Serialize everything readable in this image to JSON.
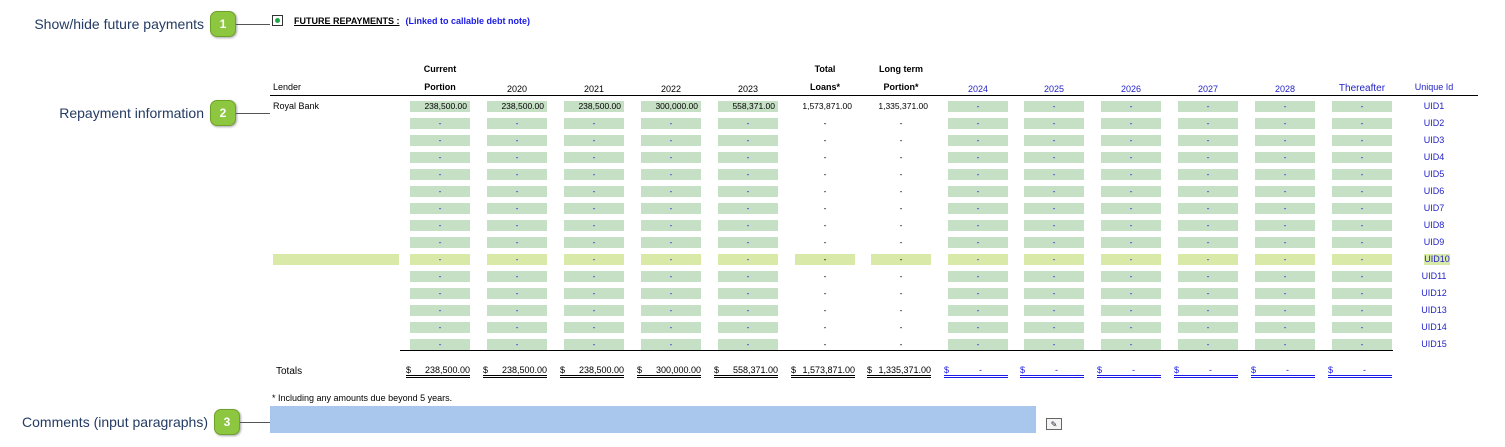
{
  "callouts": [
    {
      "label": "Show/hide future payments",
      "num": "1"
    },
    {
      "label": "Repayment information",
      "num": "2"
    },
    {
      "label": "Comments (input paragraphs)",
      "num": "3"
    }
  ],
  "section": {
    "title": "FUTURE REPAYMENTS :",
    "link_note": "(Linked to callable debt note)"
  },
  "headers": {
    "lender": "Lender",
    "current_top": "Current",
    "current_bottom": "Portion",
    "y2020": "2020",
    "y2021": "2021",
    "y2022": "2022",
    "y2023": "2023",
    "total_top": "Total",
    "total_bottom": "Loans*",
    "long_top": "Long term",
    "long_bottom": "Portion*",
    "y2024": "2024",
    "y2025": "2025",
    "y2026": "2026",
    "y2027": "2027",
    "y2028": "2028",
    "thereafter": "Thereafter",
    "unique_id": "Unique Id"
  },
  "rows": [
    {
      "lender": "Royal Bank",
      "uid": "UID1",
      "v": [
        "238,500.00",
        "238,500.00",
        "238,500.00",
        "300,000.00",
        "558,371.00",
        "1,573,871.00",
        "1,335,371.00",
        "-",
        "-",
        "-",
        "-",
        "-",
        "-"
      ]
    },
    {
      "lender": "",
      "uid": "UID2",
      "v": [
        "-",
        "-",
        "-",
        "-",
        "-",
        "-",
        "-",
        "-",
        "-",
        "-",
        "-",
        "-",
        "-"
      ]
    },
    {
      "lender": "",
      "uid": "UID3",
      "v": [
        "-",
        "-",
        "-",
        "-",
        "-",
        "-",
        "-",
        "-",
        "-",
        "-",
        "-",
        "-",
        "-"
      ]
    },
    {
      "lender": "",
      "uid": "UID4",
      "v": [
        "-",
        "-",
        "-",
        "-",
        "-",
        "-",
        "-",
        "-",
        "-",
        "-",
        "-",
        "-",
        "-"
      ]
    },
    {
      "lender": "",
      "uid": "UID5",
      "v": [
        "-",
        "-",
        "-",
        "-",
        "-",
        "-",
        "-",
        "-",
        "-",
        "-",
        "-",
        "-",
        "-"
      ]
    },
    {
      "lender": "",
      "uid": "UID6",
      "v": [
        "-",
        "-",
        "-",
        "-",
        "-",
        "-",
        "-",
        "-",
        "-",
        "-",
        "-",
        "-",
        "-"
      ]
    },
    {
      "lender": "",
      "uid": "UID7",
      "v": [
        "-",
        "-",
        "-",
        "-",
        "-",
        "-",
        "-",
        "-",
        "-",
        "-",
        "-",
        "-",
        "-"
      ]
    },
    {
      "lender": "",
      "uid": "UID8",
      "v": [
        "-",
        "-",
        "-",
        "-",
        "-",
        "-",
        "-",
        "-",
        "-",
        "-",
        "-",
        "-",
        "-"
      ]
    },
    {
      "lender": "",
      "uid": "UID9",
      "v": [
        "-",
        "-",
        "-",
        "-",
        "-",
        "-",
        "-",
        "-",
        "-",
        "-",
        "-",
        "-",
        "-"
      ]
    },
    {
      "lender": "",
      "uid": "UID10",
      "v": [
        "-",
        "-",
        "-",
        "-",
        "-",
        "-",
        "-",
        "-",
        "-",
        "-",
        "-",
        "-",
        "-"
      ]
    },
    {
      "lender": "",
      "uid": "UID11",
      "v": [
        "-",
        "-",
        "-",
        "-",
        "-",
        "-",
        "-",
        "-",
        "-",
        "-",
        "-",
        "-",
        "-"
      ]
    },
    {
      "lender": "",
      "uid": "UID12",
      "v": [
        "-",
        "-",
        "-",
        "-",
        "-",
        "-",
        "-",
        "-",
        "-",
        "-",
        "-",
        "-",
        "-"
      ]
    },
    {
      "lender": "",
      "uid": "UID13",
      "v": [
        "-",
        "-",
        "-",
        "-",
        "-",
        "-",
        "-",
        "-",
        "-",
        "-",
        "-",
        "-",
        "-"
      ]
    },
    {
      "lender": "",
      "uid": "UID14",
      "v": [
        "-",
        "-",
        "-",
        "-",
        "-",
        "-",
        "-",
        "-",
        "-",
        "-",
        "-",
        "-",
        "-"
      ]
    },
    {
      "lender": "",
      "uid": "UID15",
      "v": [
        "-",
        "-",
        "-",
        "-",
        "-",
        "-",
        "-",
        "-",
        "-",
        "-",
        "-",
        "-",
        "-"
      ]
    }
  ],
  "totals": {
    "label": "Totals",
    "currency": "$",
    "values": [
      "238,500.00",
      "238,500.00",
      "238,500.00",
      "300,000.00",
      "558,371.00",
      "1,573,871.00",
      "1,335,371.00",
      "-",
      "-",
      "-",
      "-",
      "-",
      "-"
    ]
  },
  "footnote": "* Including any amounts due beyond 5 years.",
  "comments": {
    "value": ""
  },
  "comment_button_icon": "edit-icon",
  "colors": {
    "input_green": "#c6e0c6",
    "highlight_row": "#d9eaa8",
    "comment_blue": "#a9c7ec",
    "badge_green": "#8dc63f"
  }
}
